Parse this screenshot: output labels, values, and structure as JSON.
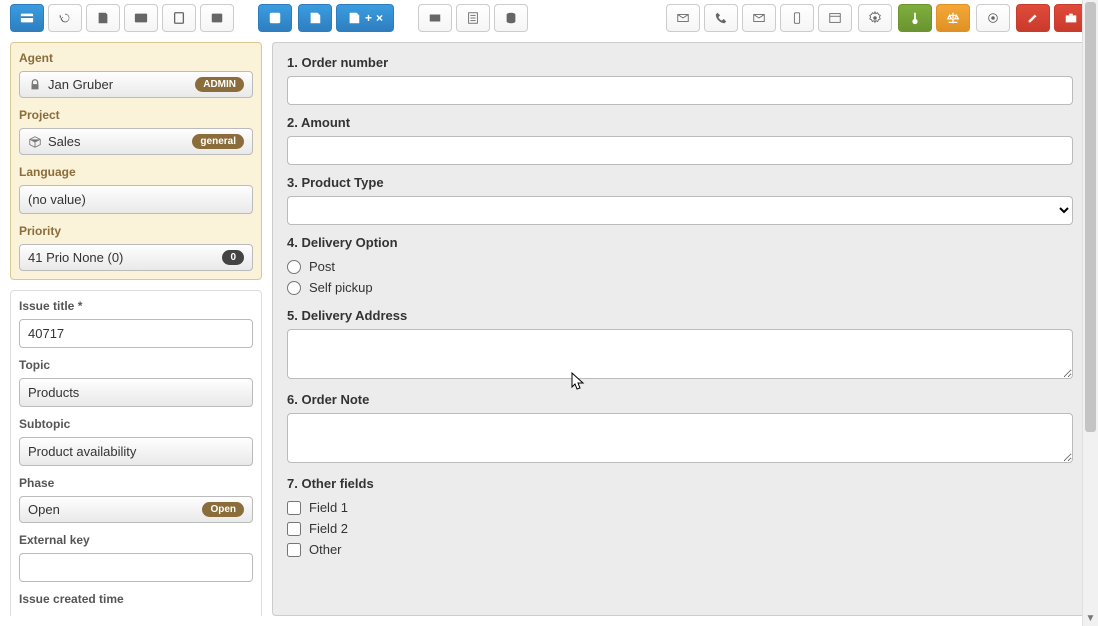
{
  "toolbar": {
    "savePlus": "+",
    "saveClose": "×"
  },
  "sidebar": {
    "agent": {
      "label": "Agent",
      "value": "Jan Gruber",
      "badge": "ADMIN"
    },
    "project": {
      "label": "Project",
      "value": "Sales",
      "badge": "general"
    },
    "language": {
      "label": "Language",
      "value": "(no value)"
    },
    "priority": {
      "label": "Priority",
      "value": "41 Prio None (0)",
      "badge": "0"
    },
    "issueTitle": {
      "label": "Issue title *",
      "value": "40717"
    },
    "topic": {
      "label": "Topic",
      "value": "Products"
    },
    "subtopic": {
      "label": "Subtopic",
      "value": "Product availability"
    },
    "phase": {
      "label": "Phase",
      "value": "Open",
      "badge": "Open"
    },
    "externalKey": {
      "label": "External key",
      "value": ""
    },
    "issueCreated": {
      "label": "Issue created time"
    }
  },
  "form": {
    "f1": {
      "label": "1. Order number"
    },
    "f2": {
      "label": "2. Amount"
    },
    "f3": {
      "label": "3. Product Type"
    },
    "f4": {
      "label": "4. Delivery Option",
      "opt1": "Post",
      "opt2": "Self pickup"
    },
    "f5": {
      "label": "5. Delivery Address"
    },
    "f6": {
      "label": "6. Order Note"
    },
    "f7": {
      "label": "7. Other fields",
      "c1": "Field 1",
      "c2": "Field 2",
      "c3": "Other"
    }
  }
}
